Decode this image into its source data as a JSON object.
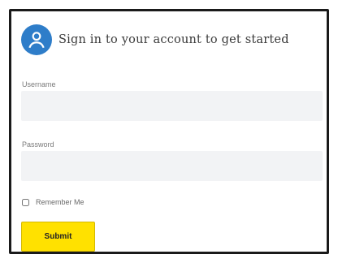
{
  "form": {
    "title": "Sign in to your account to get started",
    "username": {
      "label": "Username",
      "value": "",
      "placeholder": ""
    },
    "password": {
      "label": "Password",
      "value": "",
      "placeholder": ""
    },
    "remember_label": "Remember Me",
    "remember_checked": false,
    "submit_label": "Submit"
  },
  "icons": {
    "avatar": "user-icon"
  },
  "colors": {
    "accent": "#2e7dc9",
    "submit": "#ffe100",
    "field_bg": "#f2f3f5",
    "border": "#1a1a1a"
  }
}
